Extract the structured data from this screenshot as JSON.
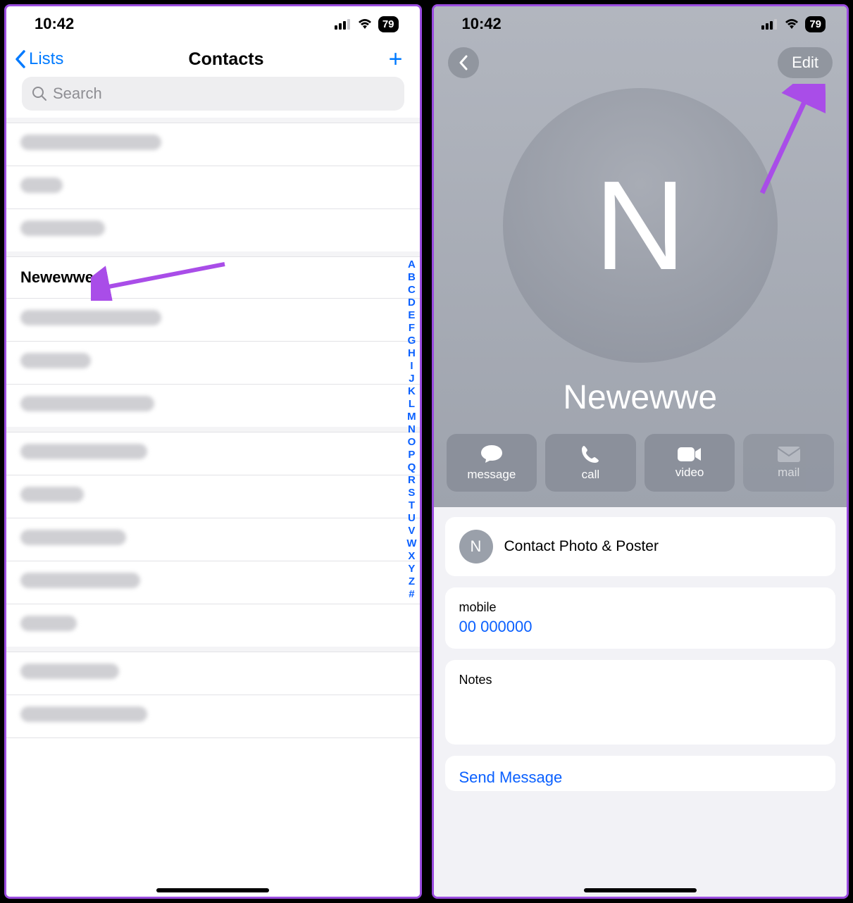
{
  "status": {
    "time": "10:42",
    "battery": "79"
  },
  "left": {
    "back_label": "Lists",
    "title": "Contacts",
    "search_placeholder": "Search",
    "highlight_contact": "Newewwe",
    "index_letters": [
      "A",
      "B",
      "C",
      "D",
      "E",
      "F",
      "G",
      "H",
      "I",
      "J",
      "K",
      "L",
      "M",
      "N",
      "O",
      "P",
      "Q",
      "R",
      "S",
      "T",
      "U",
      "V",
      "W",
      "X",
      "Y",
      "Z",
      "#"
    ]
  },
  "right": {
    "edit_label": "Edit",
    "avatar_initial": "N",
    "contact_name": "Newewwe",
    "actions": {
      "message": "message",
      "call": "call",
      "video": "video",
      "mail": "mail"
    },
    "photo_poster_label": "Contact Photo & Poster",
    "mini_initial": "N",
    "mobile_label": "mobile",
    "mobile_value": "00 000000",
    "notes_label": "Notes",
    "send_message": "Send Message"
  }
}
